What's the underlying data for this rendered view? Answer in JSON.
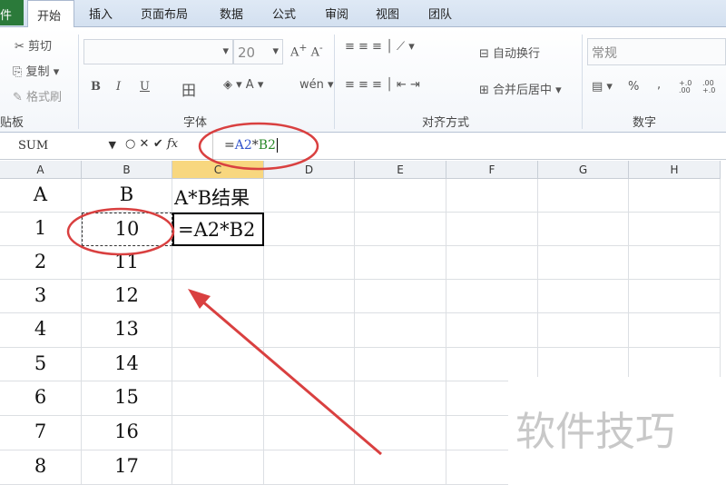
{
  "tabs": {
    "file": "件",
    "items": [
      "开始",
      "插入",
      "页面布局",
      "数据",
      "公式",
      "审阅",
      "视图",
      "团队"
    ]
  },
  "clipboard": {
    "cut": "剪切",
    "copy": "复制",
    "format_painter": "格式刷",
    "label": "贴板"
  },
  "font": {
    "size": "20",
    "bold": "B",
    "italic": "I",
    "underline": "U",
    "label": "字体"
  },
  "alignment": {
    "wrap": "自动换行",
    "merge": "合并后居中",
    "label": "对齐方式"
  },
  "number": {
    "format": "常规",
    "percent": "%",
    "comma": ",",
    "inc": "+.0 .00",
    "dec": ".00 +.0",
    "label": "数字"
  },
  "formula_bar": {
    "name_box": "SUM",
    "fx": "fx",
    "formula_eq": "=",
    "formula_a": "A2",
    "formula_op": "*",
    "formula_b": "B2"
  },
  "columns": [
    "A",
    "B",
    "C",
    "D",
    "E",
    "F",
    "G",
    "H"
  ],
  "rows": [
    [
      "A",
      "B",
      "A*B结果"
    ],
    [
      "1",
      "10",
      "=A2*B2"
    ],
    [
      "2",
      "11",
      ""
    ],
    [
      "3",
      "12",
      ""
    ],
    [
      "4",
      "13",
      ""
    ],
    [
      "5",
      "14",
      ""
    ],
    [
      "6",
      "15",
      ""
    ],
    [
      "7",
      "16",
      ""
    ],
    [
      "8",
      "17",
      ""
    ]
  ],
  "watermark": "软件技巧",
  "colors": {
    "annotation": "#d94040",
    "ref_a": "#3355cc",
    "ref_b": "#2a8a2a"
  }
}
